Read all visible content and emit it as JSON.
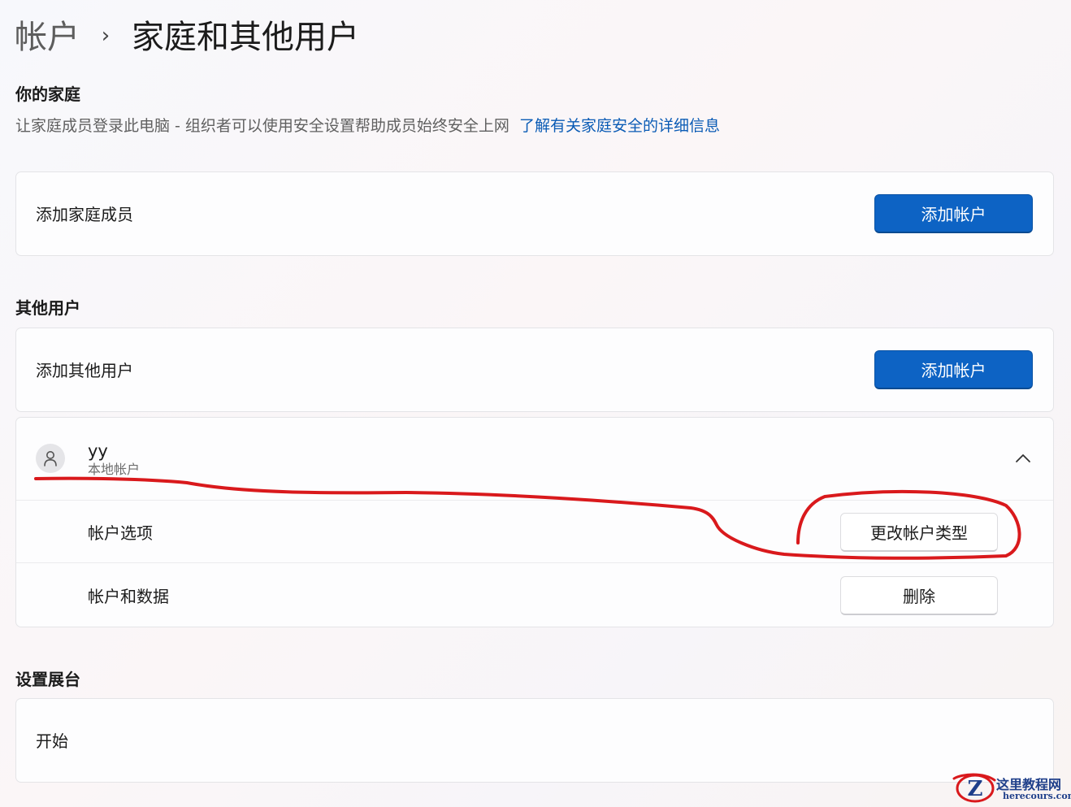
{
  "breadcrumb": {
    "parent": "帐户",
    "separator": "›",
    "current": "家庭和其他用户"
  },
  "family": {
    "title": "你的家庭",
    "description": "让家庭成员登录此电脑 - 组织者可以使用安全设置帮助成员始终安全上网",
    "link": "了解有关家庭安全的详细信息",
    "add_label": "添加家庭成员",
    "add_button": "添加帐户"
  },
  "other_users": {
    "title": "其他用户",
    "add_label": "添加其他用户",
    "add_button": "添加帐户",
    "user": {
      "name": "yy",
      "account_type": "本地帐户",
      "avatar_icon": "person-icon",
      "expand_icon": "chevron-up-icon",
      "options_label": "帐户选项",
      "change_type_button": "更改帐户类型",
      "data_label": "帐户和数据",
      "remove_button": "删除"
    }
  },
  "kiosk": {
    "title": "设置展台",
    "start_label": "开始"
  },
  "annotation": {
    "color": "#d9191c"
  },
  "watermark": {
    "cn": "这里教程网",
    "en": "herecours.com",
    "logo_letter": "Z"
  },
  "colors": {
    "accent": "#0d63c4",
    "link": "#0a5bb5"
  }
}
